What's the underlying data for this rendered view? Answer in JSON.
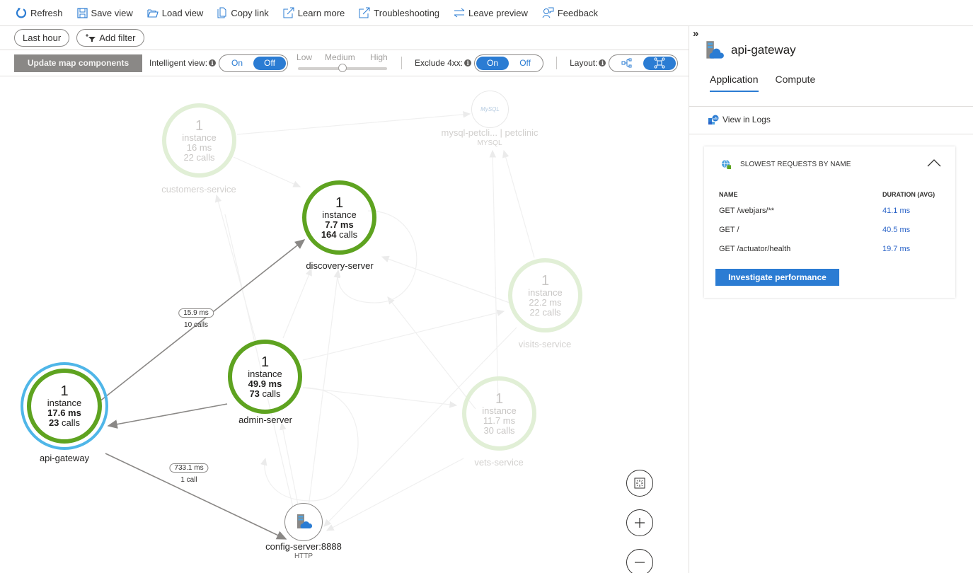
{
  "commandbar": {
    "items": [
      {
        "label": "Refresh",
        "icon": "refresh-icon"
      },
      {
        "label": "Save view",
        "icon": "save-icon"
      },
      {
        "label": "Load view",
        "icon": "folder-open-icon"
      },
      {
        "label": "Copy link",
        "icon": "copy-icon"
      },
      {
        "label": "Learn more",
        "icon": "external-link-icon"
      },
      {
        "label": "Troubleshooting",
        "icon": "external-link-icon"
      },
      {
        "label": "Leave preview",
        "icon": "swap-icon"
      },
      {
        "label": "Feedback",
        "icon": "feedback-icon"
      }
    ]
  },
  "filters": {
    "time_range": "Last hour",
    "add_filter": "Add filter"
  },
  "options": {
    "update_button": "Update map components",
    "intelligent_view": {
      "label": "Intelligent view:",
      "on": "On",
      "off": "Off",
      "selected": "Off"
    },
    "sensitivity": {
      "low": "Low",
      "medium": "Medium",
      "high": "High",
      "selected": "Medium"
    },
    "exclude_4xx": {
      "label": "Exclude 4xx:",
      "on": "On",
      "off": "Off",
      "selected": "On"
    },
    "layout": {
      "label": "Layout:",
      "options": [
        "hierarchical-layout-icon",
        "organic-layout-icon"
      ],
      "selected": "organic-layout-icon"
    }
  },
  "map": {
    "nodes": {
      "customers_service": {
        "count": "1",
        "unit": "instance",
        "duration": "16 ms",
        "calls_n": "22",
        "calls_w": "calls",
        "name": "customers-service",
        "state": "faded"
      },
      "discovery_server": {
        "count": "1",
        "unit": "instance",
        "duration": "7.7 ms",
        "calls_n": "164",
        "calls_w": "calls",
        "name": "discovery-server",
        "state": "active"
      },
      "admin_server": {
        "count": "1",
        "unit": "instance",
        "duration": "49.9 ms",
        "calls_n": "73",
        "calls_w": "calls",
        "name": "admin-server",
        "state": "active"
      },
      "api_gateway": {
        "count": "1",
        "unit": "instance",
        "duration": "17.6 ms",
        "calls_n": "23",
        "calls_w": "calls",
        "name": "api-gateway",
        "state": "selected"
      },
      "visits_service": {
        "count": "1",
        "unit": "instance",
        "duration": "22.2 ms",
        "calls_n": "22",
        "calls_w": "calls",
        "name": "visits-service",
        "state": "faded"
      },
      "vets_service": {
        "count": "1",
        "unit": "instance",
        "duration": "11.7 ms",
        "calls_n": "30",
        "calls_w": "calls",
        "name": "vets-service",
        "state": "faded"
      },
      "mysql": {
        "name": "mysql-petcli... | petclinic",
        "type": "MYSQL",
        "logo": "MySQL",
        "state": "faded"
      },
      "config_server": {
        "name": "config-server:8888",
        "type": "HTTP",
        "state": "active"
      }
    },
    "edges": {
      "gw_to_discovery": {
        "duration": "15.9 ms",
        "calls": "10 calls"
      },
      "gw_to_config": {
        "duration": "733.1 ms",
        "calls": "1 call"
      }
    },
    "controls": {
      "fit": "fit-to-screen-icon",
      "zoom_in": "zoom-in-icon",
      "zoom_out": "zoom-out-icon"
    }
  },
  "details": {
    "title": "api-gateway",
    "tabs": [
      {
        "label": "Application",
        "active": true
      },
      {
        "label": "Compute",
        "active": false
      }
    ],
    "view_in_logs": "View in Logs",
    "slowest": {
      "title": "SLOWEST REQUESTS BY NAME",
      "col_name": "NAME",
      "col_duration": "DURATION (AVG)",
      "rows": [
        {
          "name": "GET /webjars/**",
          "duration": "41.1 ms"
        },
        {
          "name": "GET /",
          "duration": "40.5 ms"
        },
        {
          "name": "GET /actuator/health",
          "duration": "19.7 ms"
        }
      ],
      "button": "Investigate performance"
    }
  },
  "colors": {
    "accent": "#2b7cd3",
    "healthy_ring": "#5ea320",
    "faded_ring": "#e1efd6",
    "selected_ring": "#4fb6e8"
  }
}
